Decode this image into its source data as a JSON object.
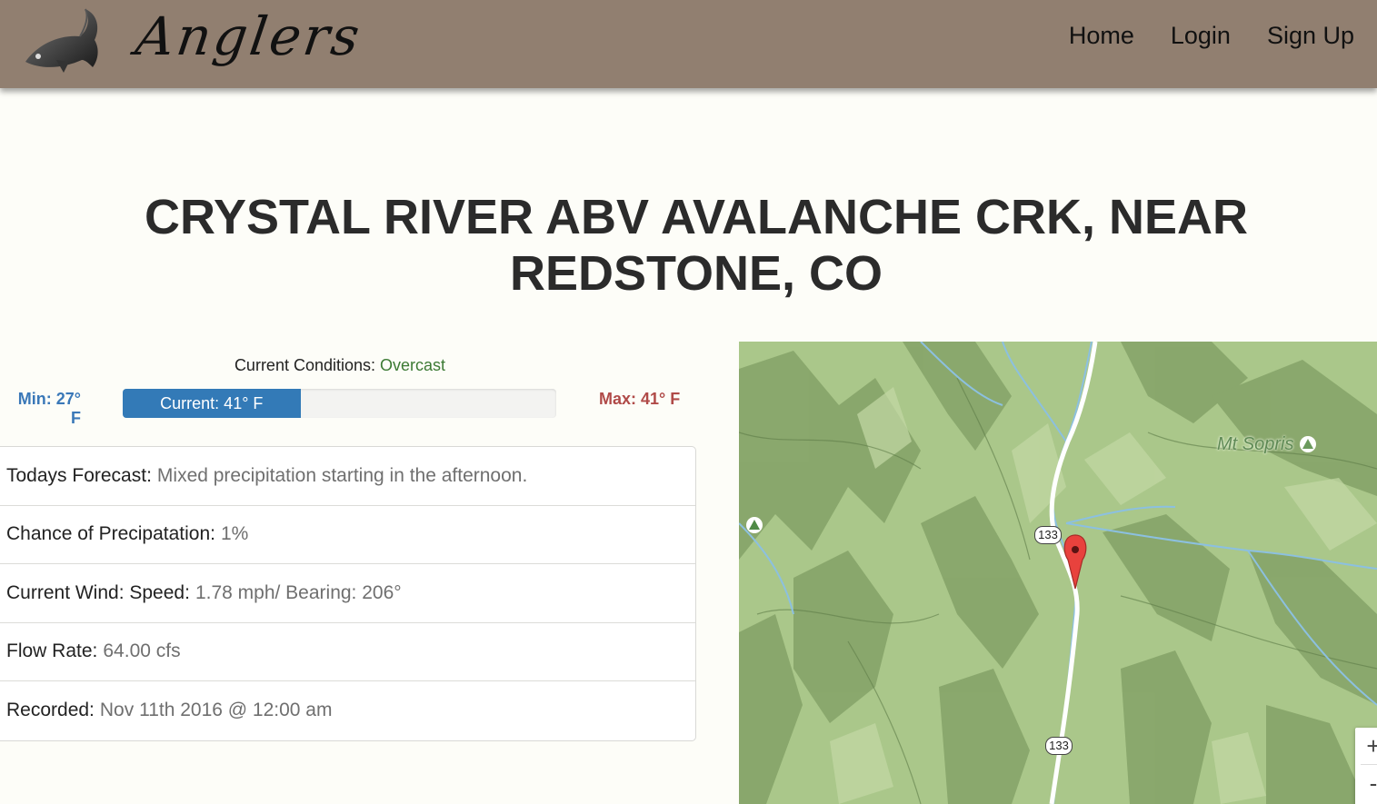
{
  "nav": {
    "brand": "Anglers",
    "links": [
      "Home",
      "Login",
      "Sign Up"
    ]
  },
  "page_title": "CRYSTAL RIVER ABV AVALANCHE CRK, NEAR REDSTONE, CO",
  "conditions": {
    "label": "Current Conditions:",
    "value": "Overcast",
    "min": "Min: 27° F",
    "max": "Max: 41° F",
    "current": "Current: 41° F",
    "bar_fraction": 0.41,
    "colors": {
      "min": "#3a78b8",
      "max": "#b04a48",
      "bar": "#337ab7",
      "condition": "#3c7a34"
    }
  },
  "details": [
    {
      "label": "Todays Forecast:",
      "value": "Mixed precipitation starting in the afternoon."
    },
    {
      "label": "Chance of Precipatation:",
      "value": "1%"
    },
    {
      "label": "Current Wind: Speed:",
      "value": "1.78 mph/ Bearing: 206°"
    },
    {
      "label": "Flow Rate:",
      "value": "64.00 cfs"
    },
    {
      "label": "Recorded:",
      "value": "Nov 11th 2016 @ 12:00 am"
    }
  ],
  "map": {
    "place_label": "Mt Sopris",
    "road_shields": [
      "133",
      "133"
    ],
    "zoom_in": "+",
    "zoom_out": "-"
  }
}
